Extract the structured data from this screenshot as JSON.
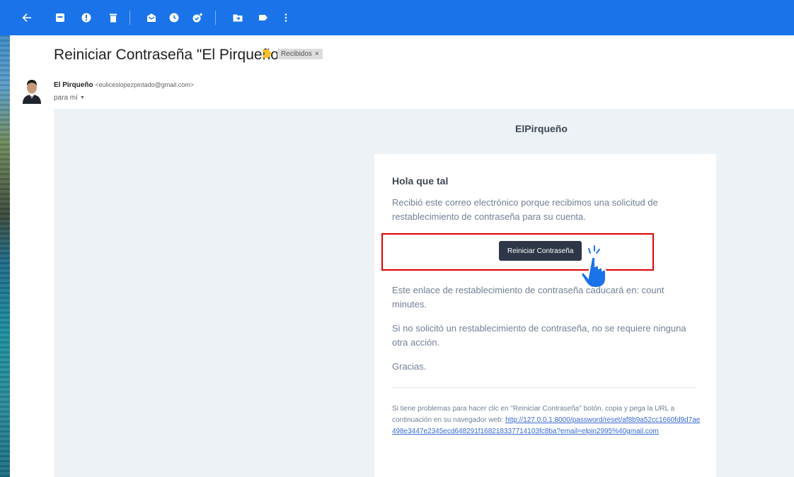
{
  "toolbar": {
    "icons": [
      "back-arrow-icon",
      "archive-icon",
      "report-spam-icon",
      "delete-icon",
      "mark-read-icon",
      "snooze-icon",
      "add-task-icon",
      "move-to-icon",
      "label-icon",
      "more-vert-icon"
    ],
    "color": "#1a73e8"
  },
  "email": {
    "subject": "Reiniciar Contraseña \"El Pirqueño\"",
    "label": "Recibidos",
    "label_close": "×",
    "sender_name": "El Pirqueño",
    "sender_email": "<euliceslopezpintado@gmail.com>",
    "to": "para mí",
    "to_caret": "▼"
  },
  "message": {
    "brand": "ElPirqueño",
    "greeting": "Hola que tal",
    "intro": "Recibió este correo electrónico porque recibimos una solicitud de restablecimiento de contraseña para su cuenta.",
    "button_label": "Reiniciar Contraseña",
    "expiry": "Este enlace de restablecimiento de contraseña caducará en: count minutes.",
    "no_action": "Si no solicitó un restablecimiento de contraseña, no se requiere ninguna otra acción.",
    "thanks": "Gracias.",
    "trouble_text": "Si tiene problemas para hacer clic en \"Reiniciar Contraseña\" botón, copia y pega la URL a continuación en su navegador web: ",
    "reset_url": "http://127.0.0.1:8000/password/reset/af8b9a52cc1660fd9d7ae498e3447e2345ecd648291f168218337714103fc8ba?email=elpin2995%40gmail.com"
  },
  "colors": {
    "highlight": "#e00000",
    "button_bg": "#2d3748",
    "link": "#3869d4",
    "body_bg": "#edf2f7"
  }
}
